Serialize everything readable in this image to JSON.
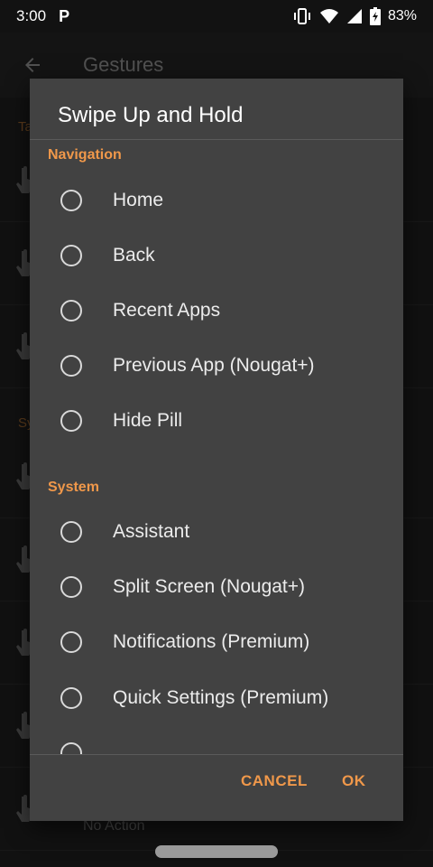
{
  "status_bar": {
    "time": "3:00",
    "app_icon": "P",
    "battery": "83%",
    "icons": [
      "vibrate-icon",
      "wifi-icon",
      "signal-icon",
      "battery-icon"
    ]
  },
  "app_bar": {
    "title": "Gestures",
    "back_icon": "arrow-left-icon"
  },
  "background": {
    "categories": [
      "Ta",
      "Sy"
    ],
    "no_action": "No Action"
  },
  "dialog": {
    "title": "Swipe Up and Hold",
    "sections": [
      {
        "header": "Navigation",
        "options": [
          "Home",
          "Back",
          "Recent Apps",
          "Previous App (Nougat+)",
          "Hide Pill"
        ]
      },
      {
        "header": "System",
        "options": [
          "Assistant",
          "Split Screen (Nougat+)",
          "Notifications (Premium)",
          "Quick Settings (Premium)"
        ]
      }
    ],
    "cancel_label": "CANCEL",
    "ok_label": "OK"
  },
  "colors": {
    "accent": "#f0984a",
    "dialog_bg": "#424242",
    "app_bg": "#1b1b1b"
  }
}
